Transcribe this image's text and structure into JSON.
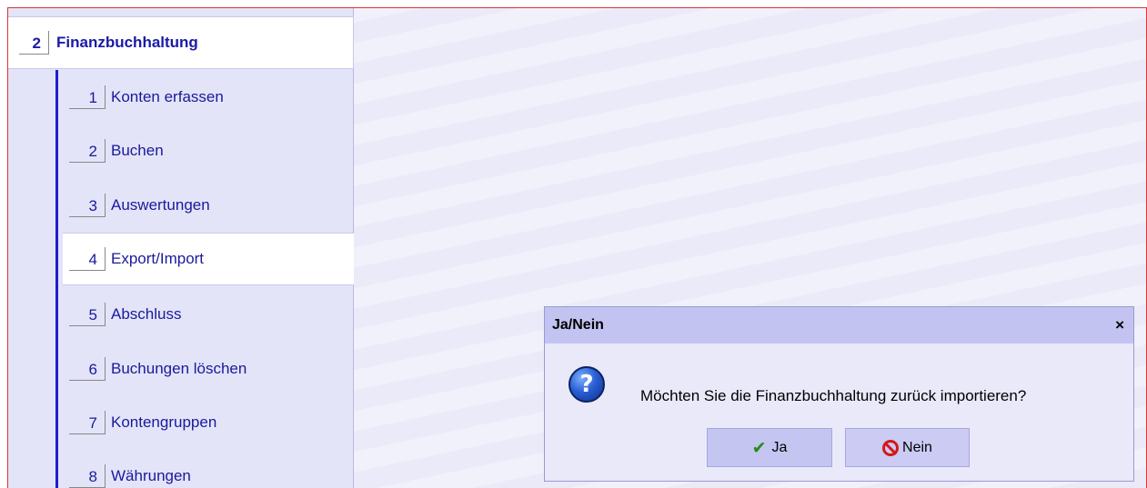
{
  "sidebar": {
    "top": {
      "num": "2",
      "label": "Finanzbuchhaltung"
    },
    "items": [
      {
        "num": "1",
        "label": "Konten erfassen"
      },
      {
        "num": "2",
        "label": "Buchen"
      },
      {
        "num": "3",
        "label": "Auswertungen"
      },
      {
        "num": "4",
        "label": "Export/Import"
      },
      {
        "num": "5",
        "label": "Abschluss"
      },
      {
        "num": "6",
        "label": "Buchungen löschen"
      },
      {
        "num": "7",
        "label": "Kontengruppen"
      },
      {
        "num": "8",
        "label": "Währungen"
      }
    ]
  },
  "dialog": {
    "title": "Ja/Nein",
    "close": "×",
    "message": "Möchten Sie die Finanzbuchhaltung zurück importieren?",
    "icon": "question-icon",
    "yes_label": "Ja",
    "no_label": "Nein"
  }
}
